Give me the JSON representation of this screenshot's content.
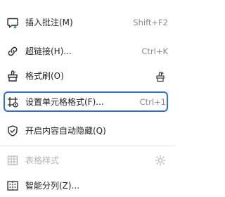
{
  "menu": {
    "items": [
      {
        "label": "插入批注(M)",
        "shortcut": "Shift+F2"
      },
      {
        "label": "超链接(H)...",
        "shortcut": "Ctrl+K"
      },
      {
        "label": "格式刷(O)",
        "shortcut": ""
      },
      {
        "label": "设置单元格格式(F)...",
        "shortcut": "Ctrl+1"
      },
      {
        "label": "开启内容自动隐藏(Q)",
        "shortcut": ""
      },
      {
        "label": "表格样式",
        "shortcut": ""
      },
      {
        "label": "智能分列(Z)...",
        "shortcut": ""
      }
    ]
  },
  "colors": {
    "highlight_border": "#2d6fd6",
    "disabled_text": "#b0b0b0",
    "shortcut_text": "#8a8a8a"
  }
}
